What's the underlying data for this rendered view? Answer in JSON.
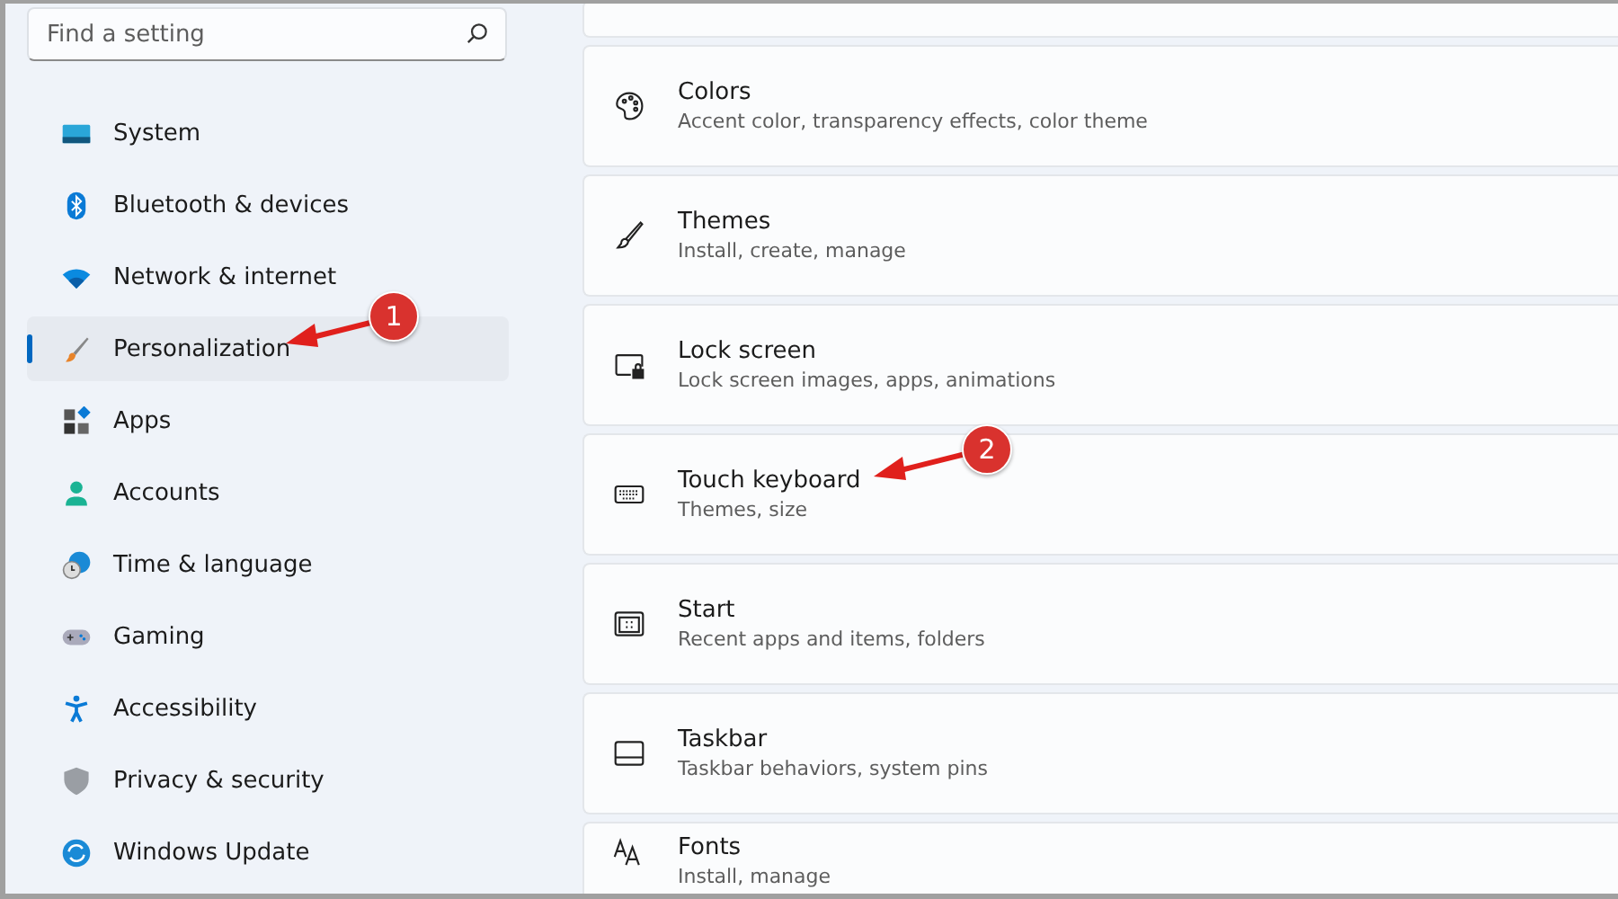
{
  "search": {
    "placeholder": "Find a setting"
  },
  "sidebar": {
    "items": [
      {
        "label": "System",
        "selected": false
      },
      {
        "label": "Bluetooth & devices",
        "selected": false
      },
      {
        "label": "Network & internet",
        "selected": false
      },
      {
        "label": "Personalization",
        "selected": true
      },
      {
        "label": "Apps",
        "selected": false
      },
      {
        "label": "Accounts",
        "selected": false
      },
      {
        "label": "Time & language",
        "selected": false
      },
      {
        "label": "Gaming",
        "selected": false
      },
      {
        "label": "Accessibility",
        "selected": false
      },
      {
        "label": "Privacy & security",
        "selected": false
      },
      {
        "label": "Windows Update",
        "selected": false
      }
    ]
  },
  "settings": [
    {
      "title": "Colors",
      "subtitle": "Accent color, transparency effects, color theme"
    },
    {
      "title": "Themes",
      "subtitle": "Install, create, manage"
    },
    {
      "title": "Lock screen",
      "subtitle": "Lock screen images, apps, animations"
    },
    {
      "title": "Touch keyboard",
      "subtitle": "Themes, size"
    },
    {
      "title": "Start",
      "subtitle": "Recent apps and items, folders"
    },
    {
      "title": "Taskbar",
      "subtitle": "Taskbar behaviors, system pins"
    },
    {
      "title": "Fonts",
      "subtitle": "Install, manage"
    }
  ],
  "annotations": [
    {
      "number": "1"
    },
    {
      "number": "2"
    }
  ]
}
